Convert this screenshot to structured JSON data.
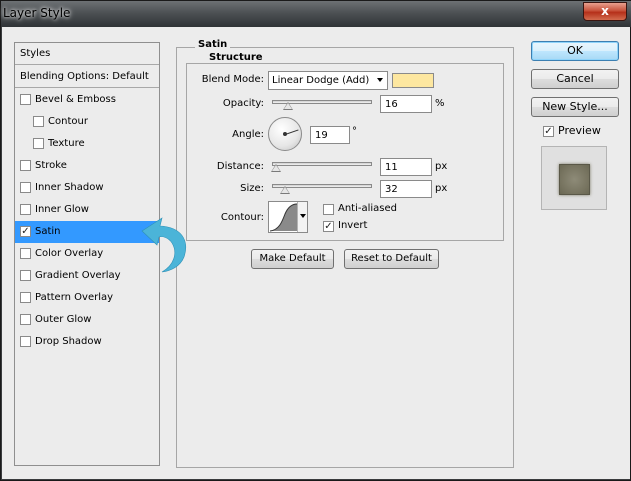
{
  "window": {
    "title": "Layer Style",
    "close_glyph": "x"
  },
  "styles_list": {
    "header_styles": "Styles",
    "header_blending": "Blending Options: Default",
    "items": [
      {
        "label": "Bevel & Emboss",
        "checked": false,
        "indent": false,
        "selected": false
      },
      {
        "label": "Contour",
        "checked": false,
        "indent": true,
        "selected": false
      },
      {
        "label": "Texture",
        "checked": false,
        "indent": true,
        "selected": false
      },
      {
        "label": "Stroke",
        "checked": false,
        "indent": false,
        "selected": false
      },
      {
        "label": "Inner Shadow",
        "checked": false,
        "indent": false,
        "selected": false
      },
      {
        "label": "Inner Glow",
        "checked": false,
        "indent": false,
        "selected": false
      },
      {
        "label": "Satin",
        "checked": true,
        "indent": false,
        "selected": true
      },
      {
        "label": "Color Overlay",
        "checked": false,
        "indent": false,
        "selected": false
      },
      {
        "label": "Gradient Overlay",
        "checked": false,
        "indent": false,
        "selected": false
      },
      {
        "label": "Pattern Overlay",
        "checked": false,
        "indent": false,
        "selected": false
      },
      {
        "label": "Outer Glow",
        "checked": false,
        "indent": false,
        "selected": false
      },
      {
        "label": "Drop Shadow",
        "checked": false,
        "indent": false,
        "selected": false
      }
    ]
  },
  "satin": {
    "group_title": "Satin",
    "structure_title": "Structure",
    "blend_mode_label": "Blend Mode:",
    "blend_mode_value": "Linear Dodge (Add)",
    "blend_color": "#fde7a0",
    "opacity_label": "Opacity:",
    "opacity_value": "16",
    "opacity_unit": "%",
    "angle_label": "Angle:",
    "angle_value": "19",
    "angle_unit": "°",
    "distance_label": "Distance:",
    "distance_value": "11",
    "distance_unit": "px",
    "size_label": "Size:",
    "size_value": "32",
    "size_unit": "px",
    "contour_label": "Contour:",
    "anti_aliased_label": "Anti-aliased",
    "anti_aliased_checked": false,
    "invert_label": "Invert",
    "invert_checked": true,
    "make_default_label": "Make Default",
    "reset_default_label": "Reset to Default"
  },
  "buttons": {
    "ok": "OK",
    "cancel": "Cancel",
    "new_style": "New Style..."
  },
  "preview": {
    "label": "Preview",
    "checked": true
  },
  "colors": {
    "selection": "#3399ff",
    "annotation_arrow": "#4bb4d8"
  },
  "checkmark": "✓"
}
